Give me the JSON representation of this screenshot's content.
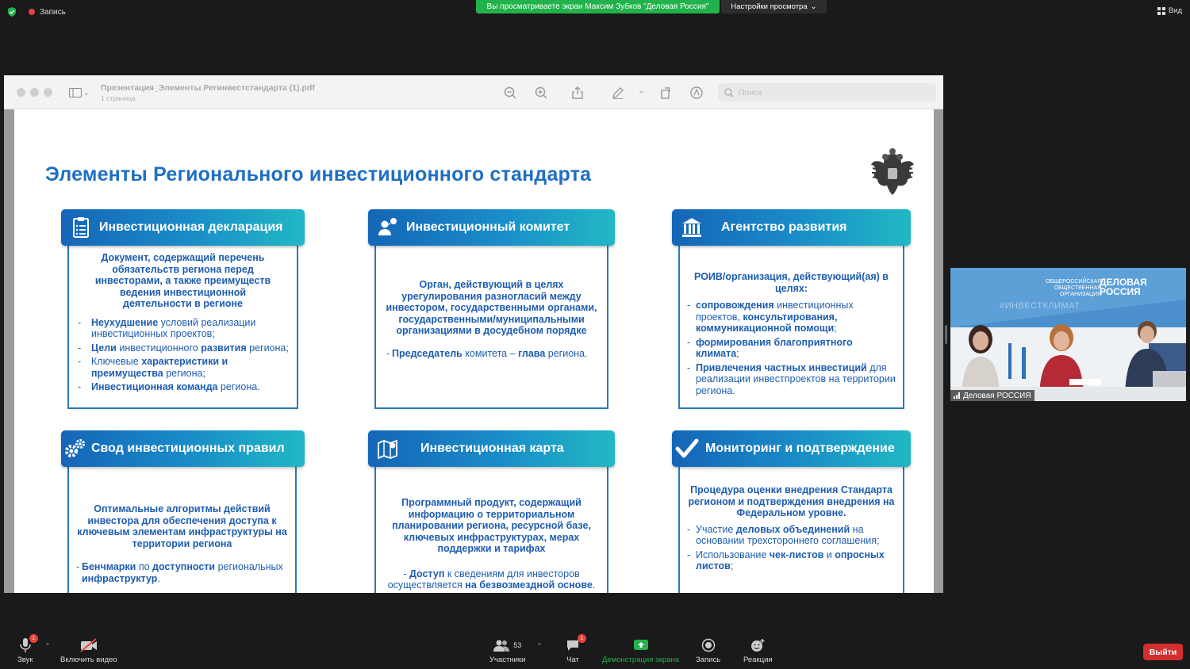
{
  "topbar": {
    "recording_label": "Запись",
    "viewing_banner": "Вы просматриваете экран Максим Зубков \"Деловая Россия\"",
    "view_settings": "Настройки просмотра",
    "view_button": "Вид"
  },
  "pdf_viewer": {
    "title": "Презентация_Элементы Регинвестстандарта (1).pdf",
    "pages": "1 страница",
    "search_placeholder": "Поиск"
  },
  "slide": {
    "title": "Элементы Регионального инвестиционного стандарта",
    "cards": [
      {
        "title": "Инвестиционная декларация",
        "icon": "clipboard-icon",
        "intro": "Документ, содержащий перечень обязательств региона перед инвесторами, а также преимуществ ведения инвестиционной деятельности в регионе",
        "items": [
          {
            "b": "Неухудшение",
            "t": " условий реализации инвестиционных проектов;"
          },
          {
            "b": "Цели",
            "t": " инвестиционного ",
            "b2": "развития",
            "t2": " региона;"
          },
          {
            "t0": "Ключевые ",
            "b": "характеристики и преимущества",
            "t": " региона;"
          },
          {
            "b": "Инвестиционная команда",
            "t": " региона."
          }
        ]
      },
      {
        "title": "Инвестиционный комитет",
        "icon": "people-icon",
        "intro": "Орган, действующий в целях урегулирования разногласий между инвестором, государственными органами, государственными/муниципальными организациями в досудебном порядке",
        "items": [
          {
            "b": "Председатель",
            "t": " комитета – ",
            "b2": "глава",
            "t2": " региона."
          }
        ]
      },
      {
        "title": "Агентство развития",
        "icon": "institution-icon",
        "intro": "РОИВ/организация, действующий(ая) в целях:",
        "items": [
          {
            "b": "сопровождения",
            "t": " инвестиционных проектов, ",
            "b2": "консультирования, коммуникационной помощи",
            "t2": ";"
          },
          {
            "b": "формирования благоприятного климата",
            "t": ";"
          },
          {
            "b": "Привлечения частных инвестиций",
            "t": " для реализации инвестпроектов на территории региона."
          }
        ]
      },
      {
        "title": "Свод инвестиционных правил",
        "icon": "gears-icon",
        "intro": "Оптимальные алгоритмы действий инвестора для обеспечения доступа к ключевым элементам инфраструктуры на территории региона",
        "items": [
          {
            "b": "Бенчмарки",
            "t": " по ",
            "b2": "доступности",
            "t2": " региональных ",
            "b3": "инфраструктур",
            "t3": "."
          }
        ]
      },
      {
        "title": "Инвестиционная карта",
        "icon": "map-icon",
        "intro": "Программный продукт, содержащий информацию о территориальном планировании региона, ресурсной базе, ключевых инфраструктурах, мерах поддержки и тарифах",
        "items": [
          {
            "b": "Доступ",
            "t": " к сведениям для инвесторов осуществляется ",
            "b2": "на безвозмездной основе",
            "t2": "."
          }
        ]
      },
      {
        "title": "Мониторинг и подтверждение",
        "icon": "checkmark-icon",
        "intro": "Процедура оценки внедрения Стандарта регионом и подтверждения внедрения на Федеральном уровне.",
        "items": [
          {
            "t0": "Участие ",
            "b": "деловых объединений",
            "t": " на основании трехстороннего соглашения;"
          },
          {
            "t0": "Использование ",
            "b": "чек-листов",
            "t": " и ",
            "b2": "опросных листов",
            "t2": ";"
          }
        ]
      }
    ]
  },
  "webcam": {
    "name": "Деловая РОССИЯ",
    "logo_line1": "ОБЩЕРОССИЙСКАЯ",
    "logo_line2": "ОБЩЕСТВЕННАЯ",
    "logo_line3": "ОРГАНИЗАЦИЯ",
    "logo_brand1": "ДЕЛОВАЯ",
    "logo_brand2": "РОССИЯ",
    "hashtag": "#ИНВЕСТКЛИМАТ"
  },
  "bottombar": {
    "audio": "Звук",
    "video": "Включить видео",
    "participants": "Участники",
    "participants_count": "53",
    "chat": "Чат",
    "chat_badge": "1",
    "audio_badge": "1",
    "share": "Демонстрация экрана",
    "record": "Запись",
    "reactions": "Реакции",
    "exit": "Выйти"
  },
  "colors": {
    "banner_green": "#22b24c",
    "slide_blue": "#1e6fc4",
    "header_gradient_start": "#1565b7",
    "header_gradient_end": "#21b8c3",
    "exit_red": "#d32f2f"
  }
}
